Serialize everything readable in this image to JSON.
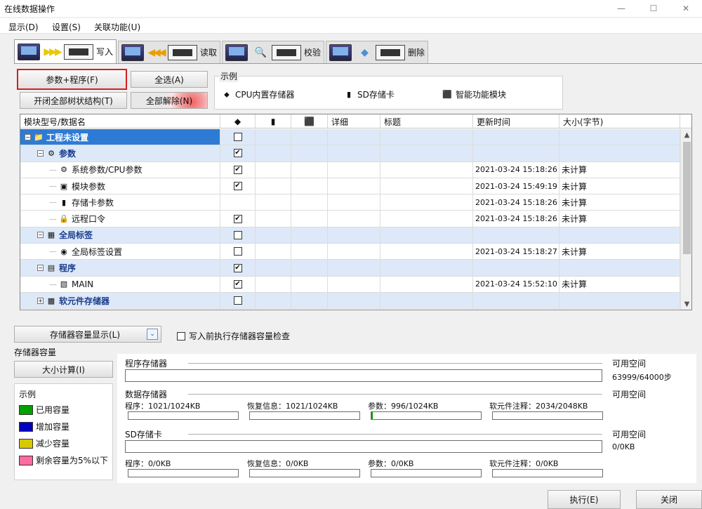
{
  "window": {
    "title": "在线数据操作",
    "min": "—",
    "max": "☐",
    "close": "✕"
  },
  "menu": [
    "显示(D)",
    "设置(S)",
    "关联功能(U)"
  ],
  "tabs": [
    {
      "label": "写入",
      "active": true,
      "arrow": "▶▶▶",
      "arrow_color": "#e8c800"
    },
    {
      "label": "读取",
      "active": false,
      "arrow": "◀◀◀",
      "arrow_color": "#e8a000"
    },
    {
      "label": "校验",
      "active": false,
      "arrow": "🔍",
      "arrow_color": "#40a040"
    },
    {
      "label": "删除",
      "active": false,
      "arrow": "◆",
      "arrow_color": "#4a90d8"
    }
  ],
  "buttons": {
    "param_program": "参数+程序(F)",
    "select_all": "全选(A)",
    "toggle_tree": "开闭全部树状结构(T)",
    "deselect_all": "全部解除(N)"
  },
  "legend": {
    "title": "示例",
    "items": [
      {
        "label": "CPU内置存储器",
        "icon": "cpu-memory-icon",
        "glyph": "⬥"
      },
      {
        "label": "SD存储卡",
        "icon": "sd-card-icon",
        "glyph": "▮"
      },
      {
        "label": "智能功能模块",
        "icon": "intelligent-module-icon",
        "glyph": "⬛"
      }
    ]
  },
  "table": {
    "headers": [
      "模块型号/数据名",
      "◆",
      "▮",
      "⬛",
      "详细",
      "标题",
      "更新时间",
      "大小(字节)"
    ],
    "rows": [
      {
        "indent": 0,
        "name": "工程未设置",
        "group": true,
        "selected": true,
        "expander": "−",
        "icon": "📁",
        "cpu": "",
        "updated": "",
        "size": ""
      },
      {
        "indent": 1,
        "name": "参数",
        "group": true,
        "expander": "−",
        "icon": "⚙",
        "cpu": "✔",
        "updated": "",
        "size": ""
      },
      {
        "indent": 2,
        "name": "系统参数/CPU参数",
        "group": false,
        "icon": "⚙",
        "cpu": "✔",
        "updated": "2021-03-24 15:18:26",
        "size": "未计算"
      },
      {
        "indent": 2,
        "name": "模块参数",
        "group": false,
        "icon": "▣",
        "cpu": "✔",
        "updated": "2021-03-24 15:49:19",
        "size": "未计算"
      },
      {
        "indent": 2,
        "name": "存储卡参数",
        "group": false,
        "icon": "▮",
        "cpu": null,
        "updated": "2021-03-24 15:18:26",
        "size": "未计算"
      },
      {
        "indent": 2,
        "name": "远程口令",
        "group": false,
        "icon": "🔒",
        "cpu": "✔",
        "updated": "2021-03-24 15:18:26",
        "size": "未计算"
      },
      {
        "indent": 1,
        "name": "全局标签",
        "group": true,
        "expander": "−",
        "icon": "▦",
        "cpu": "",
        "updated": "",
        "size": ""
      },
      {
        "indent": 2,
        "name": "全局标签设置",
        "group": false,
        "icon": "◉",
        "cpu": "",
        "updated": "2021-03-24 15:18:27",
        "size": "未计算"
      },
      {
        "indent": 1,
        "name": "程序",
        "group": true,
        "expander": "−",
        "icon": "▤",
        "cpu": "✔",
        "updated": "",
        "size": ""
      },
      {
        "indent": 2,
        "name": "MAIN",
        "group": false,
        "icon": "▧",
        "cpu": "✔",
        "updated": "2021-03-24 15:52:10",
        "size": "未计算"
      },
      {
        "indent": 1,
        "name": "软元件存储器",
        "group": true,
        "expander": "+",
        "icon": "▩",
        "cpu": "",
        "updated": "",
        "size": ""
      }
    ]
  },
  "capacity": {
    "display_button": "存储器容量显示(L)",
    "check_label": "写入前执行存储器容量检查",
    "section_title": "存储器容量",
    "calc_button": "大小计算(I)",
    "available": "可用空间",
    "program_memory": {
      "label": "程序存储器",
      "avail": "63999/64000步"
    },
    "data_memory": {
      "label": "数据存储器",
      "program": "程序：1021/1024KB",
      "recovery": "恢复信息：1021/1024KB",
      "param": "参数：996/1024KB",
      "param_used_fraction": 0.015,
      "comment": "软元件注释：2034/2048KB"
    },
    "sd_card": {
      "label": "SD存储卡",
      "avail": "0/0KB",
      "program": "程序：0/0KB",
      "recovery": "恢复信息：0/0KB",
      "param": "参数：0/0KB",
      "comment": "软元件注释：0/0KB"
    }
  },
  "legend_panel": {
    "title": "示例",
    "items": [
      {
        "label": "已用容量",
        "color": "#00a000"
      },
      {
        "label": "增加容量",
        "color": "#0000c0"
      },
      {
        "label": "减少容量",
        "color": "#d8c800"
      },
      {
        "label": "剩余容量为5%以下",
        "color": "#ff6aa0"
      }
    ]
  },
  "footer": {
    "execute": "执行(E)",
    "close": "关闭"
  }
}
